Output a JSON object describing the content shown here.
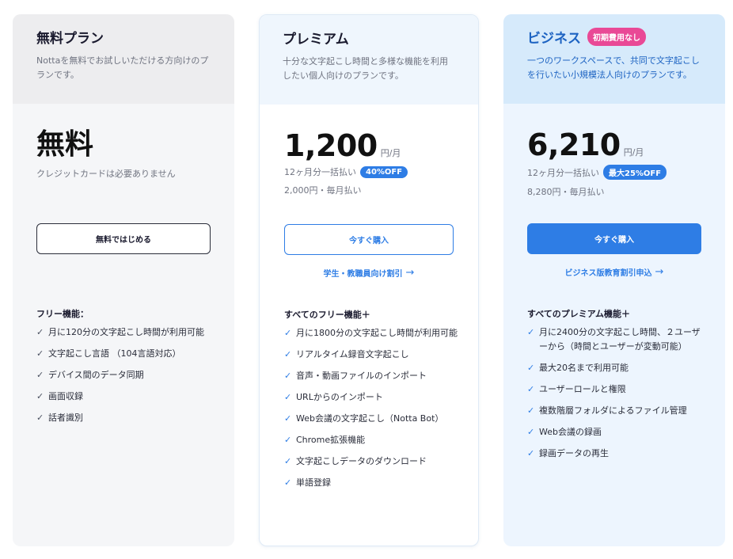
{
  "plans": {
    "free": {
      "name": "無料プラン",
      "desc": "Nottaを無料でお試しいただける方向けのプランです。",
      "price": "無料",
      "price_note": "クレジットカードは必要ありません",
      "cta": "無料ではじめる",
      "features_title": "フリー機能：",
      "features": [
        "月に120分の文字起こし時間が利用可能",
        "文字起こし言語 （104言語対応）",
        "デバイス間のデータ同期",
        "画面収録",
        "話者識別"
      ]
    },
    "premium": {
      "name": "プレミアム",
      "desc": "十分な文字起こし時間と多様な機能を利用したい個人向けのプランです。",
      "price": "1,200",
      "unit": "円/月",
      "annual": "12ヶ月分一括払い",
      "discount": "40%OFF",
      "monthly": "2,000円・毎月払い",
      "cta": "今すぐ購入",
      "link": "学生・教職員向け割引",
      "features_title": "すべてのフリー機能＋",
      "features": [
        "月に1800分の文字起こし時間が利用可能",
        "リアルタイム録音文字起こし",
        "音声・動画ファイルのインポート",
        "URLからのインポート",
        "Web会議の文字起こし（Notta Bot）",
        "Chrome拡張機能",
        "文字起こしデータのダウンロード",
        "単語登録"
      ]
    },
    "business": {
      "name": "ビジネス",
      "badge": "初期費用なし",
      "desc": "一つのワークスペースで、共同で文字起こしを行いたい小規模法人向けのプランです。",
      "price": "6,210",
      "unit": "円/月",
      "annual": "12ヶ月分一括払い",
      "discount": "最大25%OFF",
      "monthly": "8,280円・毎月払い",
      "cta": "今すぐ購入",
      "link": "ビジネス版教育割引申込",
      "features_title": "すべてのプレミアム機能＋",
      "features": [
        "月に2400分の文字起こし時間、２ユーザーから（時間とユーザーが変動可能）",
        "最大20名まで利用可能",
        "ユーザーロールと権限",
        "複数階層フォルダによるファイル管理",
        "Web会議の録画",
        "録画データの再生"
      ]
    }
  },
  "icons": {
    "check": "check-icon",
    "arrow": "arrow-right-icon"
  },
  "colors": {
    "accent": "#2e7de5",
    "badge_pink": "#e94996",
    "business_text": "#1d63c2"
  }
}
